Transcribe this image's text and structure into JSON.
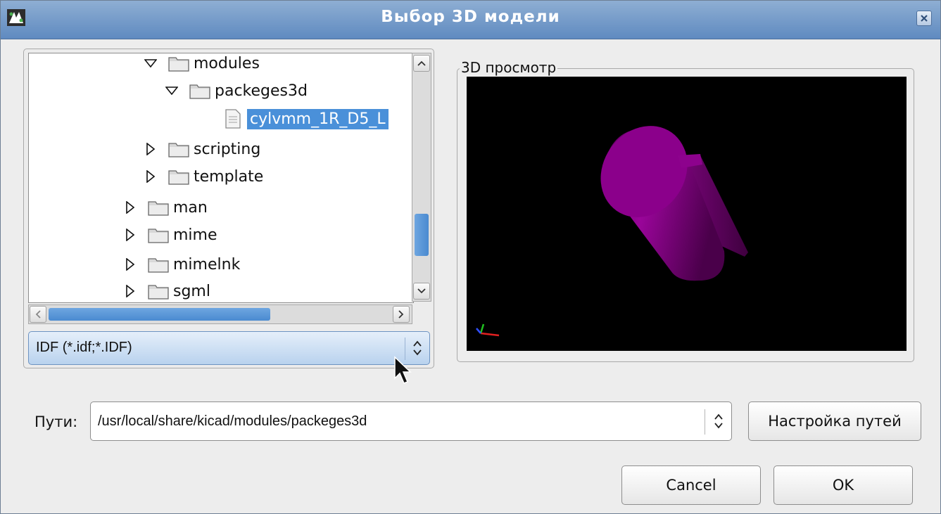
{
  "window": {
    "title": "Выбор 3D модели"
  },
  "tree": {
    "items": [
      {
        "label": "modules",
        "expanded": true,
        "type": "folder"
      },
      {
        "label": "packeges3d",
        "expanded": true,
        "type": "folder"
      },
      {
        "label": "cylvmm_1R_D5_L",
        "type": "file",
        "selected": true
      },
      {
        "label": "scripting",
        "expanded": false,
        "type": "folder"
      },
      {
        "label": "template",
        "expanded": false,
        "type": "folder"
      },
      {
        "label": "man",
        "expanded": false,
        "type": "folder"
      },
      {
        "label": "mime",
        "expanded": false,
        "type": "folder"
      },
      {
        "label": "mimelnk",
        "expanded": false,
        "type": "folder"
      },
      {
        "label": "sgml",
        "expanded": false,
        "type": "folder"
      }
    ]
  },
  "filter": {
    "value": "IDF (*.idf;*.IDF)"
  },
  "preview": {
    "label": "3D просмотр",
    "model_color": "#8b008b"
  },
  "paths": {
    "label": "Пути:",
    "value": "/usr/local/share/kicad/modules/packeges3d",
    "configure_label": "Настройка путей"
  },
  "buttons": {
    "cancel": "Cancel",
    "ok": "OK"
  },
  "colors": {
    "titlebar": "#7a9cc8",
    "selection": "#4a90d9",
    "accent": "#5f8ac0"
  }
}
